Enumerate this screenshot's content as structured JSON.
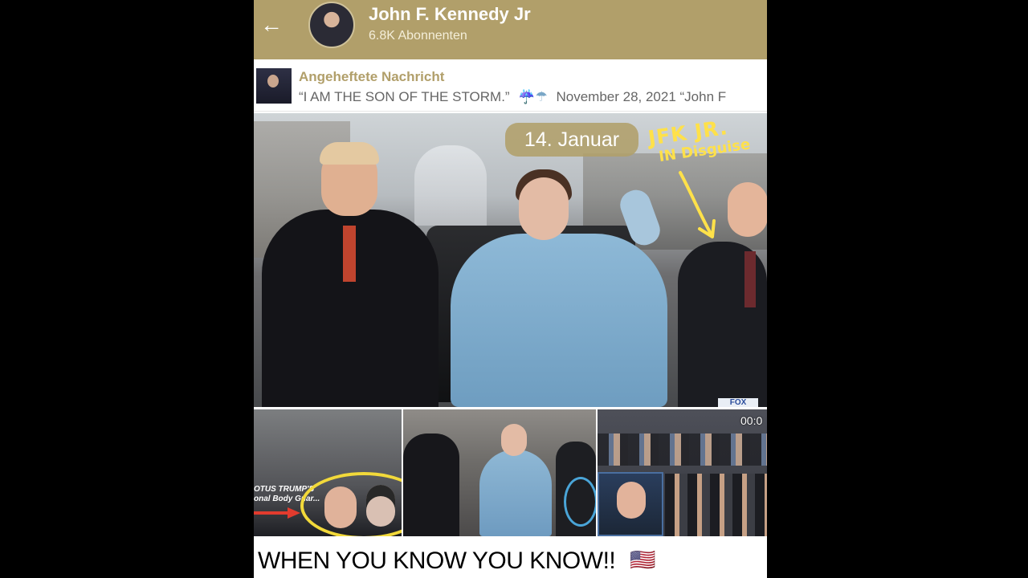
{
  "header": {
    "back_icon": "arrow-left-icon",
    "channel_name": "John F. Kennedy Jr",
    "subscribers": "6.8K Abonnenten",
    "bg_color": "#b19f6a"
  },
  "pinned": {
    "label": "Angeheftete Nachricht",
    "text": "“I AM THE SON OF THE STORM.”",
    "emoji": "☔☂",
    "date_text": "November 28, 2021 “John F"
  },
  "post": {
    "date_chip": "14. Januar",
    "annotation_line1": "JFK JR.",
    "annotation_line2": "IN Disguise",
    "watermark": "FOX",
    "thumb1_label_line1": "OTUS TRUMP'S",
    "thumb1_label_line2": "onal Body Guar...",
    "thumb3_timer": "00:0",
    "caption": "WHEN YOU KNOW YOU KNOW!!",
    "caption_flag": "🇺🇸"
  }
}
